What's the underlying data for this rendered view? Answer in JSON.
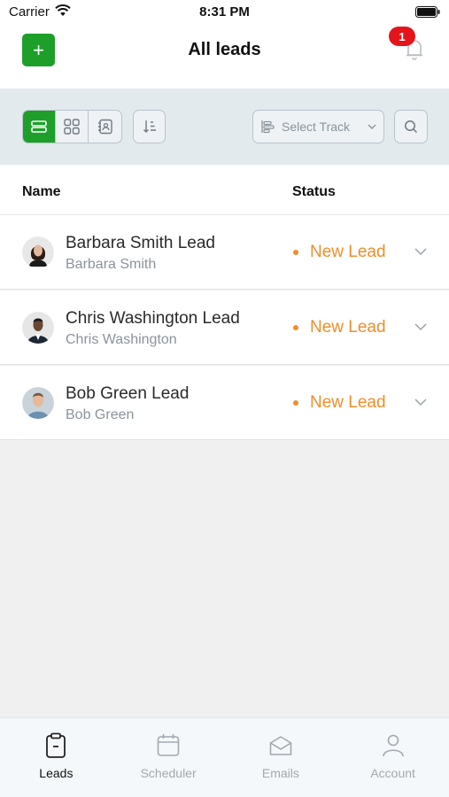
{
  "status_bar": {
    "carrier": "Carrier",
    "time": "8:31 PM"
  },
  "nav": {
    "title": "All leads",
    "add_label": "+",
    "notification_count": "1"
  },
  "toolbar": {
    "track_placeholder": "Select Track"
  },
  "table": {
    "headers": {
      "name": "Name",
      "status": "Status"
    },
    "rows": [
      {
        "lead": "Barbara Smith Lead",
        "contact": "Barbara Smith",
        "status": "New Lead",
        "avatar": "woman-avatar"
      },
      {
        "lead": "Chris Washington Lead",
        "contact": "Chris Washington",
        "status": "New Lead",
        "avatar": "man-suit-avatar"
      },
      {
        "lead": "Bob Green Lead",
        "contact": "Bob Green",
        "status": "New Lead",
        "avatar": "man-avatar"
      }
    ]
  },
  "tabs": [
    {
      "label": "Leads",
      "icon": "clipboard-icon",
      "active": true
    },
    {
      "label": "Scheduler",
      "icon": "calendar-icon",
      "active": false
    },
    {
      "label": "Emails",
      "icon": "envelope-icon",
      "active": false
    },
    {
      "label": "Account",
      "icon": "user-icon",
      "active": false
    }
  ],
  "colors": {
    "accent": "#1d9f2a",
    "status": "#f28c28",
    "badge": "#e5141b",
    "toolbar_bg": "#e3eaee"
  }
}
